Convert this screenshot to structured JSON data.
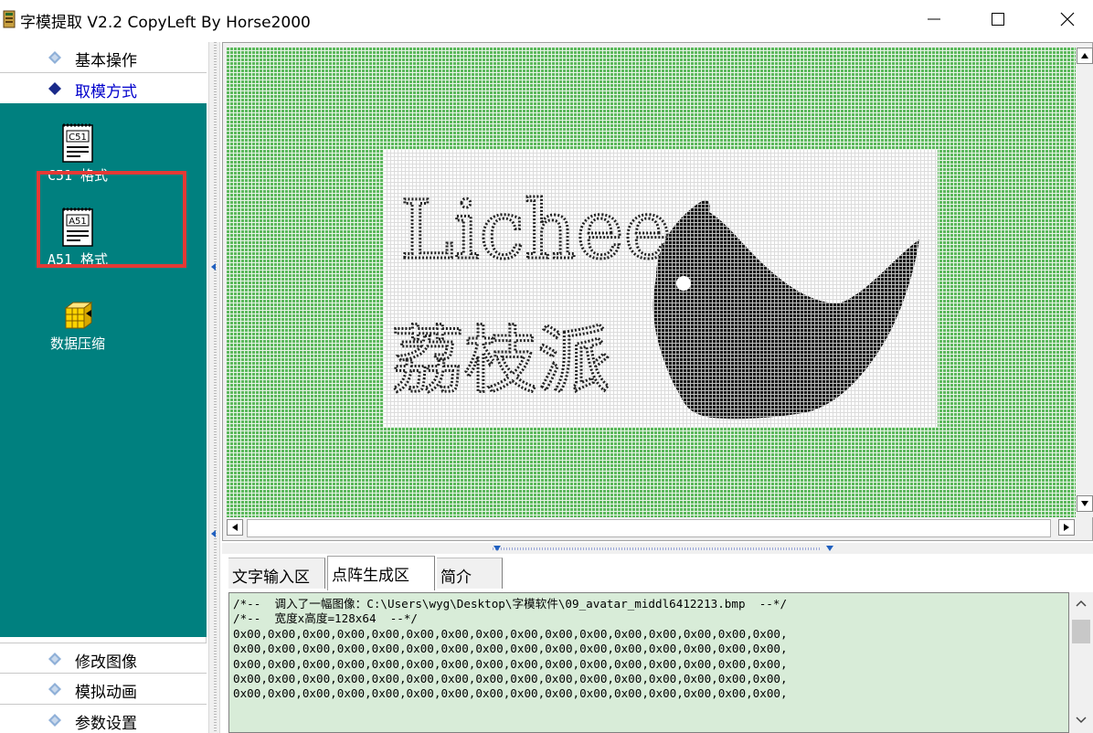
{
  "window": {
    "title": "字模提取 V2.2  CopyLeft By Horse2000"
  },
  "sidebar": {
    "groups_top": [
      {
        "label": "基本操作",
        "active": false
      },
      {
        "label": "取模方式",
        "active": true
      }
    ],
    "tools": [
      {
        "label": "C51 格式",
        "icon": "c51-doc-icon",
        "icon_text": "C51"
      },
      {
        "label": "A51 格式",
        "icon": "a51-doc-icon",
        "icon_text": "A51"
      },
      {
        "label": "数据压缩",
        "icon": "compress-cube-icon"
      }
    ],
    "groups_bottom": [
      {
        "label": "修改图像"
      },
      {
        "label": "模拟动画"
      },
      {
        "label": "参数设置"
      }
    ],
    "highlight_color": "#e53935",
    "panel_color": "#00807f"
  },
  "canvas": {
    "grid_color": "#5cb85c",
    "text_latin": "Lichee",
    "text_chinese": "荔枝派"
  },
  "tabs": [
    {
      "label": "文字输入区",
      "active": false
    },
    {
      "label": "点阵生成区",
      "active": true
    },
    {
      "label": "简介",
      "active": false
    }
  ],
  "output": {
    "lines": [
      "/*--  调入了一幅图像：C:\\Users\\wyg\\Desktop\\字模软件\\09_avatar_middl6412213.bmp  --*/",
      "/*--  宽度x高度=128x64  --*/",
      "0x00,0x00,0x00,0x00,0x00,0x00,0x00,0x00,0x00,0x00,0x00,0x00,0x00,0x00,0x00,0x00,",
      "0x00,0x00,0x00,0x00,0x00,0x00,0x00,0x00,0x00,0x00,0x00,0x00,0x00,0x00,0x00,0x00,",
      "0x00,0x00,0x00,0x00,0x00,0x00,0x00,0x00,0x00,0x00,0x00,0x00,0x00,0x00,0x00,0x00,",
      "0x00,0x00,0x00,0x00,0x00,0x00,0x00,0x00,0x00,0x00,0x00,0x00,0x00,0x00,0x00,0x00,",
      "0x00,0x00,0x00,0x00,0x00,0x00,0x00,0x00,0x00,0x00,0x00,0x00,0x00,0x00,0x00,0x00,"
    ]
  }
}
